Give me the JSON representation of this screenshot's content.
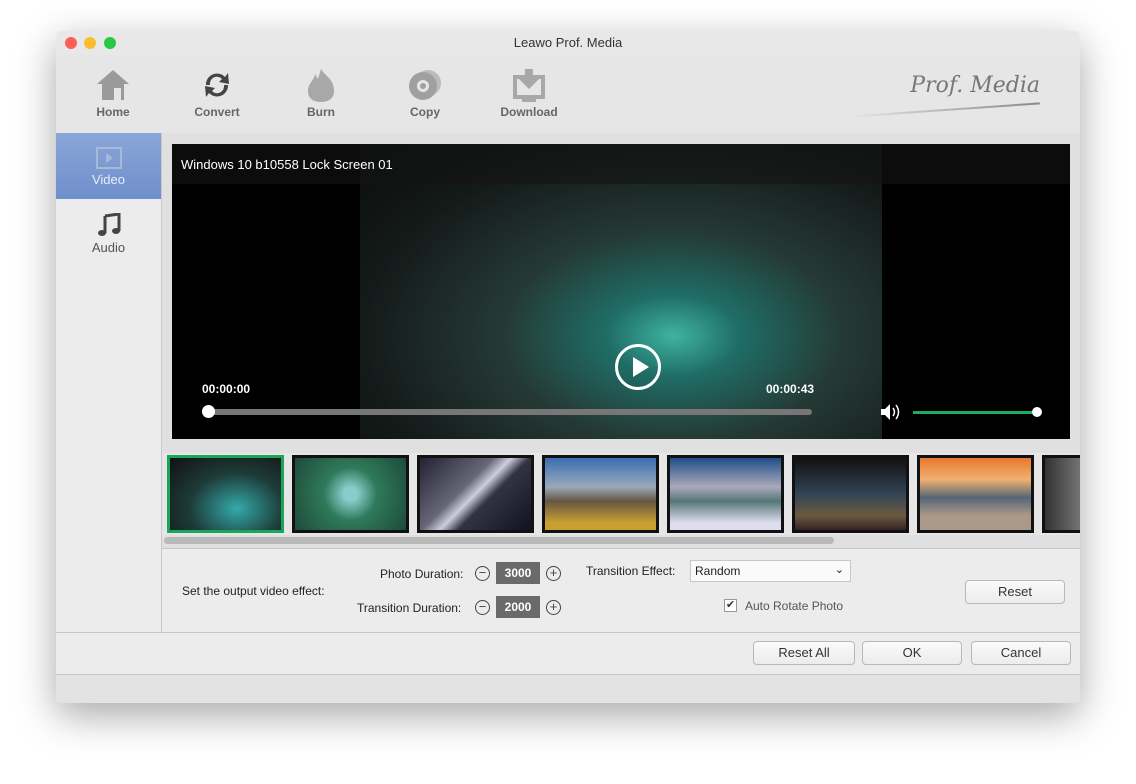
{
  "window": {
    "title": "Leawo Prof. Media"
  },
  "toolbar": {
    "items": [
      {
        "label": "Home",
        "icon": "home-icon"
      },
      {
        "label": "Convert",
        "icon": "convert-icon"
      },
      {
        "label": "Burn",
        "icon": "burn-icon"
      },
      {
        "label": "Copy",
        "icon": "copy-icon"
      },
      {
        "label": "Download",
        "icon": "download-icon"
      }
    ],
    "logo": "Prof. Media"
  },
  "sidebar": {
    "items": [
      {
        "label": "Video",
        "active": true
      },
      {
        "label": "Audio",
        "active": false
      }
    ]
  },
  "player": {
    "title": "Windows 10 b10558 Lock Screen 01",
    "current_time": "00:00:00",
    "duration": "00:00:43",
    "progress": 0,
    "volume": 1.0
  },
  "thumbnails": {
    "count_visible": 8,
    "selected": 0
  },
  "settings": {
    "intro": "Set the output video effect:",
    "photo_duration_label": "Photo Duration:",
    "photo_duration": "3000",
    "transition_duration_label": "Transition Duration:",
    "transition_duration": "2000",
    "transition_effect_label": "Transition Effect:",
    "transition_effect": "Random",
    "auto_rotate_label": "Auto Rotate Photo",
    "auto_rotate": true,
    "reset": "Reset"
  },
  "footer": {
    "reset_all": "Reset All",
    "ok": "OK",
    "cancel": "Cancel"
  }
}
